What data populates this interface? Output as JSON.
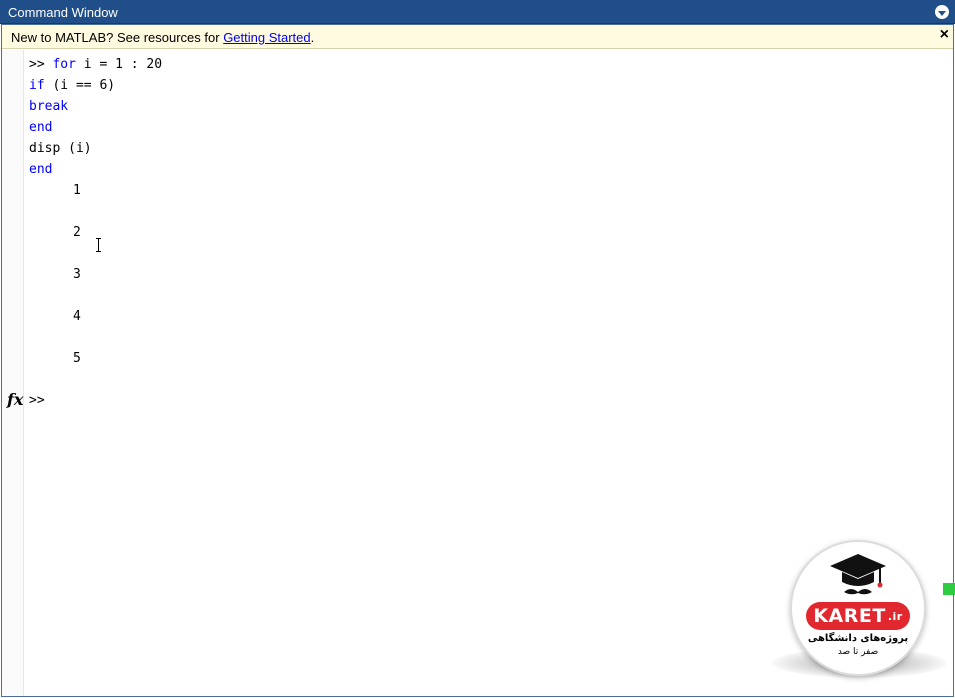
{
  "window": {
    "title": "Command Window",
    "menu_icon": "circle-chevron-down-icon"
  },
  "notice": {
    "text_before": "New to MATLAB? See resources for ",
    "link_text": "Getting Started",
    "text_after": ".",
    "close_icon": "close-icon",
    "close_glyph": "×"
  },
  "code": {
    "prompt": ">>",
    "lines": [
      {
        "kw": "for",
        "rest": " i = 1 : 20"
      },
      {
        "kw": "if",
        "rest": " (i == 6)"
      },
      {
        "kw": "break",
        "rest": ""
      },
      {
        "kw": "end",
        "rest": ""
      },
      {
        "kw": "",
        "rest": "disp (i)"
      },
      {
        "kw": "end",
        "rest": ""
      }
    ]
  },
  "output": [
    "1",
    "2",
    "3",
    "4",
    "5"
  ],
  "gutter": {
    "fx_label": "fx",
    "prompt": ">>"
  },
  "logo": {
    "brand": "KARET",
    "suffix": ".ir",
    "tagline": "پروژه‌های دانشگاهی",
    "subline": "صفر تا صد",
    "badge_color": "#e0282e"
  },
  "colors": {
    "titlebar": "#1f4e88",
    "keyword": "#0000ff",
    "notice_bg": "#fffbe0",
    "link": "#0000ee"
  }
}
